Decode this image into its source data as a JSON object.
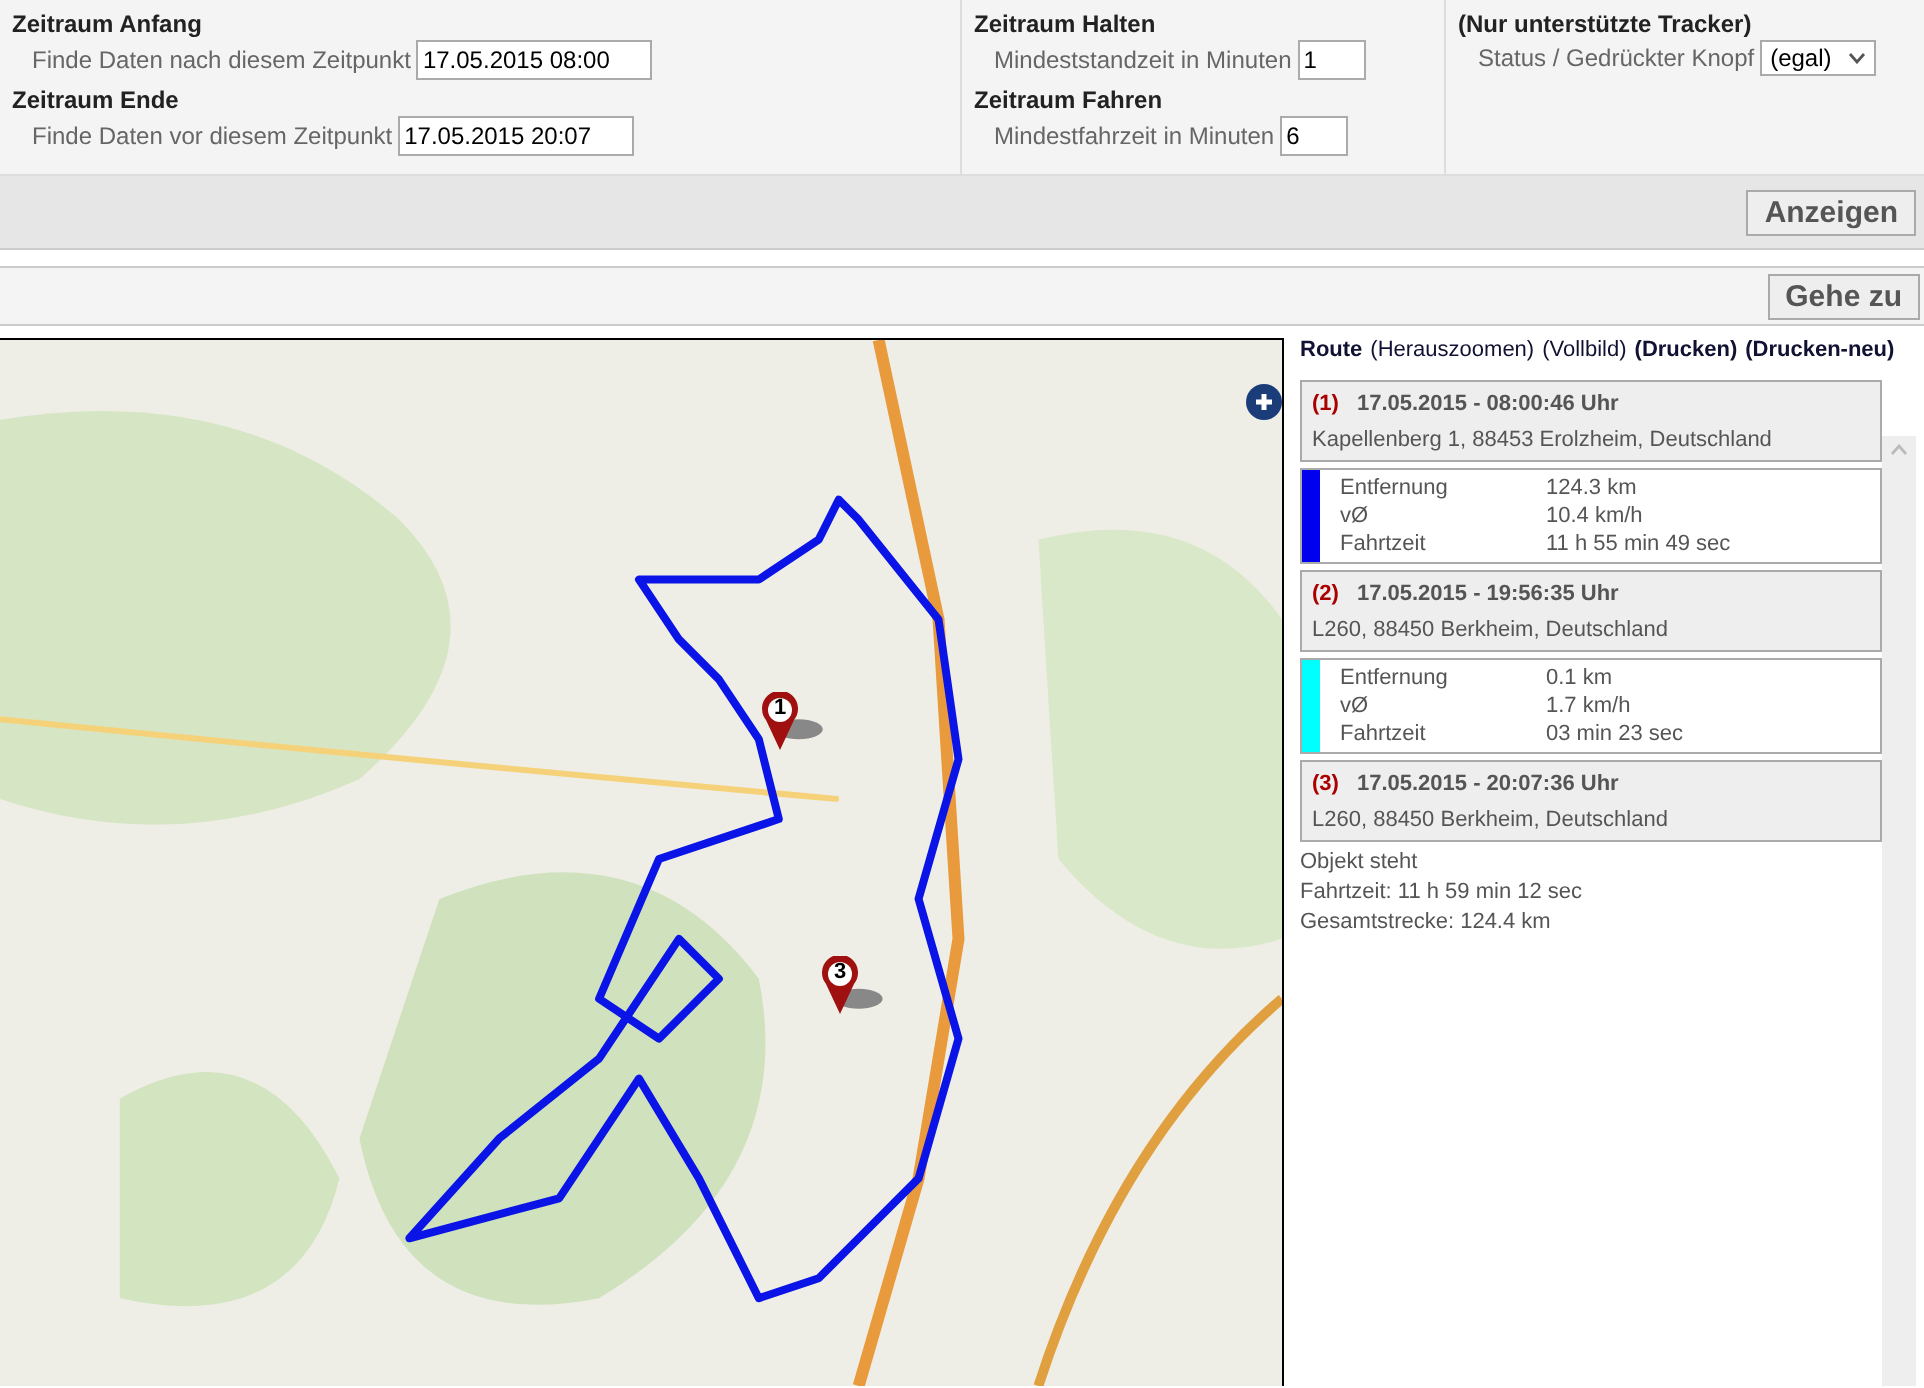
{
  "filters": [
    {
      "title": "Zeitraum Anfang",
      "label": "Finde Daten nach diesem Zeitpunkt",
      "value": "17.05.2015 08:00",
      "kind": "wide"
    },
    {
      "title": "Zeitraum Ende",
      "label": "Finde Daten vor diesem Zeitpunkt",
      "value": "17.05.2015 20:07",
      "kind": "wide"
    },
    {
      "title": "Zeitraum Halten",
      "label": "Mindeststandzeit in Minuten",
      "value": "1",
      "kind": "narrow"
    },
    {
      "title": "Zeitraum Fahren",
      "label": "Mindestfahrzeit in Minuten",
      "value": "6",
      "kind": "narrow"
    }
  ],
  "tracker": {
    "title": "(Nur unterstützte Tracker)",
    "label": "Status / Gedrückter Knopf",
    "value": "(egal)"
  },
  "show_button": "Anzeigen",
  "goto_button": "Gehe zu",
  "map": {
    "kind": "picture",
    "markers": [
      {
        "label": "1"
      },
      {
        "label": "3"
      }
    ]
  },
  "route": {
    "title": "Route",
    "links": [
      "(Herauszoomen)",
      "(Vollbild)",
      "(Drucken)",
      "(Drucken-neu)"
    ],
    "items": [
      {
        "kind": "stop",
        "number": "(1)",
        "time": "17.05.2015 - 08:00:46 Uhr",
        "address": "Kapellenberg 1, 88453 Erolzheim, Deutschland"
      },
      {
        "kind": "segment",
        "color": "#0000ee",
        "rows": [
          [
            "Entfernung",
            "124.3 km"
          ],
          [
            "vØ",
            "10.4 km/h"
          ],
          [
            "Fahrtzeit",
            "11 h 55 min 49 sec"
          ]
        ]
      },
      {
        "kind": "stop",
        "number": "(2)",
        "time": "17.05.2015 - 19:56:35 Uhr",
        "address": "L260, 88450 Berkheim, Deutschland"
      },
      {
        "kind": "segment",
        "color": "#00ffff",
        "rows": [
          [
            "Entfernung",
            "0.1 km"
          ],
          [
            "vØ",
            "1.7 km/h"
          ],
          [
            "Fahrtzeit",
            "03 min 23 sec"
          ]
        ]
      },
      {
        "kind": "stop",
        "number": "(3)",
        "time": "17.05.2015 - 20:07:36 Uhr",
        "address": "L260, 88450 Berkheim, Deutschland"
      }
    ],
    "summary": [
      "Objekt steht",
      "Fahrtzeit: 11 h 59 min 12 sec",
      "Gesamtstrecke: 124.4 km"
    ]
  }
}
